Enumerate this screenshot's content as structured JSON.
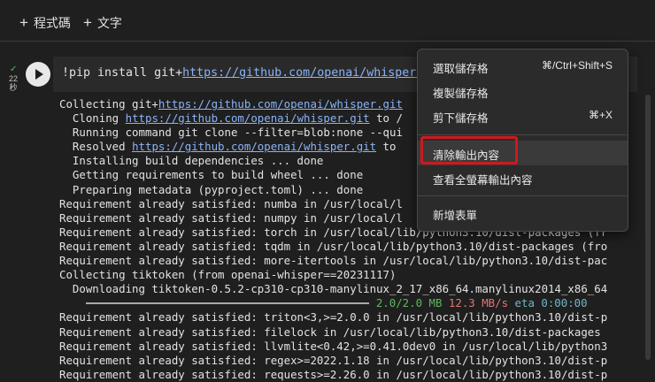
{
  "toolbar": {
    "add_code_label": "程式碼",
    "add_text_label": "文字"
  },
  "cell": {
    "status_time": "22",
    "status_unit": "秒",
    "input_prefix": "!pip install git+",
    "input_url": "https://github.com/openai/whisper.g"
  },
  "output": {
    "lines": [
      {
        "text": "Collecting git+",
        "link": "https://github.com/openai/whisper.git"
      },
      {
        "text": "  Cloning ",
        "link": "https://github.com/openai/whisper.git",
        "tail": " to /"
      },
      {
        "text": "  Running command git clone --filter=blob:none --qui"
      },
      {
        "text": "  Resolved ",
        "link": "https://github.com/openai/whisper.git",
        "tail": " to"
      },
      {
        "text": "  Installing build dependencies ... done"
      },
      {
        "text": "  Getting requirements to build wheel ... done"
      },
      {
        "text": "  Preparing metadata (pyproject.toml) ... done"
      },
      {
        "text": "Requirement already satisfied: numba in /usr/local/l"
      },
      {
        "text": "Requirement already satisfied: numpy in /usr/local/l"
      },
      {
        "text": "Requirement already satisfied: torch in /usr/local/lib/python3.10/dist-packages (fr"
      },
      {
        "text": "Requirement already satisfied: tqdm in /usr/local/lib/python3.10/dist-packages (fro"
      },
      {
        "text": "Requirement already satisfied: more-itertools in /usr/local/lib/python3.10/dist-pac"
      },
      {
        "text": "Collecting tiktoken (from openai-whisper==20231117)"
      },
      {
        "text": "  Downloading tiktoken-0.5.2-cp310-cp310-manylinux_2_17_x86_64.manylinux2014_x86_64"
      },
      {
        "progress": true,
        "size": "2.0/2.0 MB",
        "speed": "12.3 MB/s",
        "eta": "eta 0:00:00"
      },
      {
        "text": "Requirement already satisfied: triton<3,>=2.0.0 in /usr/local/lib/python3.10/dist-p"
      },
      {
        "text": "Requirement already satisfied: filelock in /usr/local/lib/python3.10/dist-packages"
      },
      {
        "text": "Requirement already satisfied: llvmlite<0.42,>=0.41.0dev0 in /usr/local/lib/python3"
      },
      {
        "text": "Requirement already satisfied: regex>=2022.1.18 in /usr/local/lib/python3.10/dist-p"
      },
      {
        "text": "Requirement already satisfied: requests>=2.26.0 in /usr/local/lib/python3.10/dist-p"
      }
    ]
  },
  "context_menu": {
    "items": [
      {
        "label": "選取儲存格",
        "shortcut": "⌘/Ctrl+Shift+S"
      },
      {
        "label": "複製儲存格",
        "shortcut": ""
      },
      {
        "label": "剪下儲存格",
        "shortcut": "⌘+X"
      },
      {
        "label": "清除輸出內容",
        "shortcut": ""
      },
      {
        "label": "查看全螢幕輸出內容",
        "shortcut": ""
      },
      {
        "label": "新增表單",
        "shortcut": ""
      }
    ]
  },
  "colors": {
    "highlight": "#d0181f",
    "link": "#8ab4f8",
    "progress_green": "#5fb65f"
  }
}
